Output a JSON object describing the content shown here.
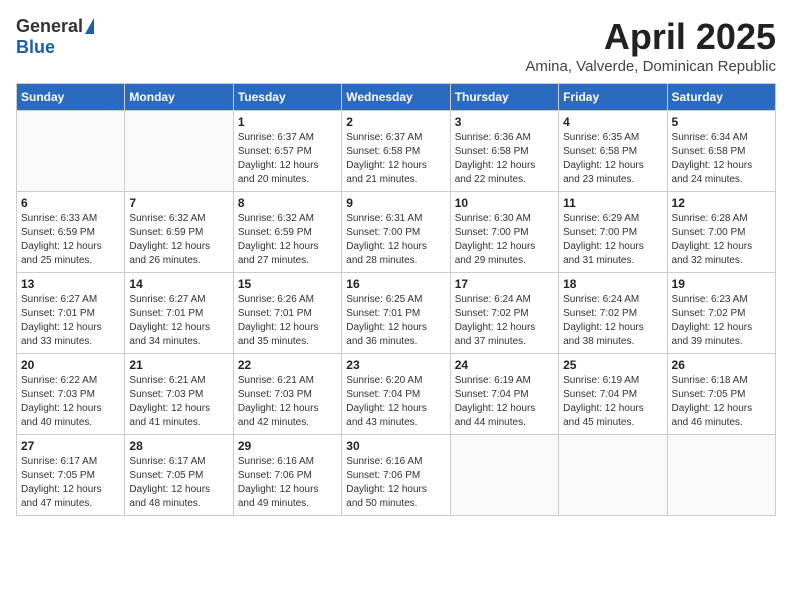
{
  "header": {
    "logo_general": "General",
    "logo_blue": "Blue",
    "title": "April 2025",
    "location": "Amina, Valverde, Dominican Republic"
  },
  "weekdays": [
    "Sunday",
    "Monday",
    "Tuesday",
    "Wednesday",
    "Thursday",
    "Friday",
    "Saturday"
  ],
  "weeks": [
    [
      null,
      null,
      {
        "day": 1,
        "sunrise": "6:37 AM",
        "sunset": "6:57 PM",
        "daylight": "12 hours and 20 minutes."
      },
      {
        "day": 2,
        "sunrise": "6:37 AM",
        "sunset": "6:58 PM",
        "daylight": "12 hours and 21 minutes."
      },
      {
        "day": 3,
        "sunrise": "6:36 AM",
        "sunset": "6:58 PM",
        "daylight": "12 hours and 22 minutes."
      },
      {
        "day": 4,
        "sunrise": "6:35 AM",
        "sunset": "6:58 PM",
        "daylight": "12 hours and 23 minutes."
      },
      {
        "day": 5,
        "sunrise": "6:34 AM",
        "sunset": "6:58 PM",
        "daylight": "12 hours and 24 minutes."
      }
    ],
    [
      {
        "day": 6,
        "sunrise": "6:33 AM",
        "sunset": "6:59 PM",
        "daylight": "12 hours and 25 minutes."
      },
      {
        "day": 7,
        "sunrise": "6:32 AM",
        "sunset": "6:59 PM",
        "daylight": "12 hours and 26 minutes."
      },
      {
        "day": 8,
        "sunrise": "6:32 AM",
        "sunset": "6:59 PM",
        "daylight": "12 hours and 27 minutes."
      },
      {
        "day": 9,
        "sunrise": "6:31 AM",
        "sunset": "7:00 PM",
        "daylight": "12 hours and 28 minutes."
      },
      {
        "day": 10,
        "sunrise": "6:30 AM",
        "sunset": "7:00 PM",
        "daylight": "12 hours and 29 minutes."
      },
      {
        "day": 11,
        "sunrise": "6:29 AM",
        "sunset": "7:00 PM",
        "daylight": "12 hours and 31 minutes."
      },
      {
        "day": 12,
        "sunrise": "6:28 AM",
        "sunset": "7:00 PM",
        "daylight": "12 hours and 32 minutes."
      }
    ],
    [
      {
        "day": 13,
        "sunrise": "6:27 AM",
        "sunset": "7:01 PM",
        "daylight": "12 hours and 33 minutes."
      },
      {
        "day": 14,
        "sunrise": "6:27 AM",
        "sunset": "7:01 PM",
        "daylight": "12 hours and 34 minutes."
      },
      {
        "day": 15,
        "sunrise": "6:26 AM",
        "sunset": "7:01 PM",
        "daylight": "12 hours and 35 minutes."
      },
      {
        "day": 16,
        "sunrise": "6:25 AM",
        "sunset": "7:01 PM",
        "daylight": "12 hours and 36 minutes."
      },
      {
        "day": 17,
        "sunrise": "6:24 AM",
        "sunset": "7:02 PM",
        "daylight": "12 hours and 37 minutes."
      },
      {
        "day": 18,
        "sunrise": "6:24 AM",
        "sunset": "7:02 PM",
        "daylight": "12 hours and 38 minutes."
      },
      {
        "day": 19,
        "sunrise": "6:23 AM",
        "sunset": "7:02 PM",
        "daylight": "12 hours and 39 minutes."
      }
    ],
    [
      {
        "day": 20,
        "sunrise": "6:22 AM",
        "sunset": "7:03 PM",
        "daylight": "12 hours and 40 minutes."
      },
      {
        "day": 21,
        "sunrise": "6:21 AM",
        "sunset": "7:03 PM",
        "daylight": "12 hours and 41 minutes."
      },
      {
        "day": 22,
        "sunrise": "6:21 AM",
        "sunset": "7:03 PM",
        "daylight": "12 hours and 42 minutes."
      },
      {
        "day": 23,
        "sunrise": "6:20 AM",
        "sunset": "7:04 PM",
        "daylight": "12 hours and 43 minutes."
      },
      {
        "day": 24,
        "sunrise": "6:19 AM",
        "sunset": "7:04 PM",
        "daylight": "12 hours and 44 minutes."
      },
      {
        "day": 25,
        "sunrise": "6:19 AM",
        "sunset": "7:04 PM",
        "daylight": "12 hours and 45 minutes."
      },
      {
        "day": 26,
        "sunrise": "6:18 AM",
        "sunset": "7:05 PM",
        "daylight": "12 hours and 46 minutes."
      }
    ],
    [
      {
        "day": 27,
        "sunrise": "6:17 AM",
        "sunset": "7:05 PM",
        "daylight": "12 hours and 47 minutes."
      },
      {
        "day": 28,
        "sunrise": "6:17 AM",
        "sunset": "7:05 PM",
        "daylight": "12 hours and 48 minutes."
      },
      {
        "day": 29,
        "sunrise": "6:16 AM",
        "sunset": "7:06 PM",
        "daylight": "12 hours and 49 minutes."
      },
      {
        "day": 30,
        "sunrise": "6:16 AM",
        "sunset": "7:06 PM",
        "daylight": "12 hours and 50 minutes."
      },
      null,
      null,
      null
    ]
  ],
  "labels": {
    "sunrise": "Sunrise:",
    "sunset": "Sunset:",
    "daylight": "Daylight:"
  }
}
